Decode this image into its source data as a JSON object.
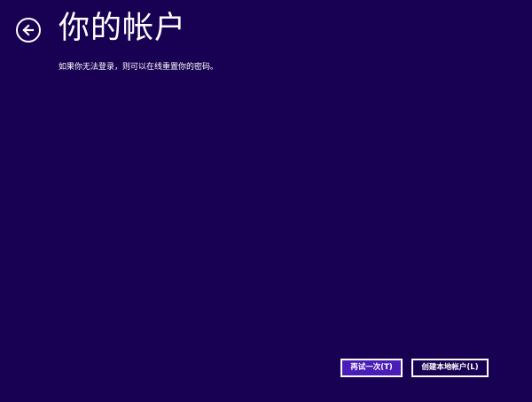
{
  "header": {
    "back_icon": "arrow-left-circle-icon",
    "title": "你的帐户"
  },
  "main": {
    "description": "如果你无法登录，则可以在线重置你的密码。"
  },
  "footer": {
    "retry_label": "再试一次(T)",
    "create_local_account_label": "创建本地帐户(L)"
  },
  "colors": {
    "background": "#180052",
    "primary_button": "#4a1cb8",
    "foreground": "#ffffff"
  }
}
